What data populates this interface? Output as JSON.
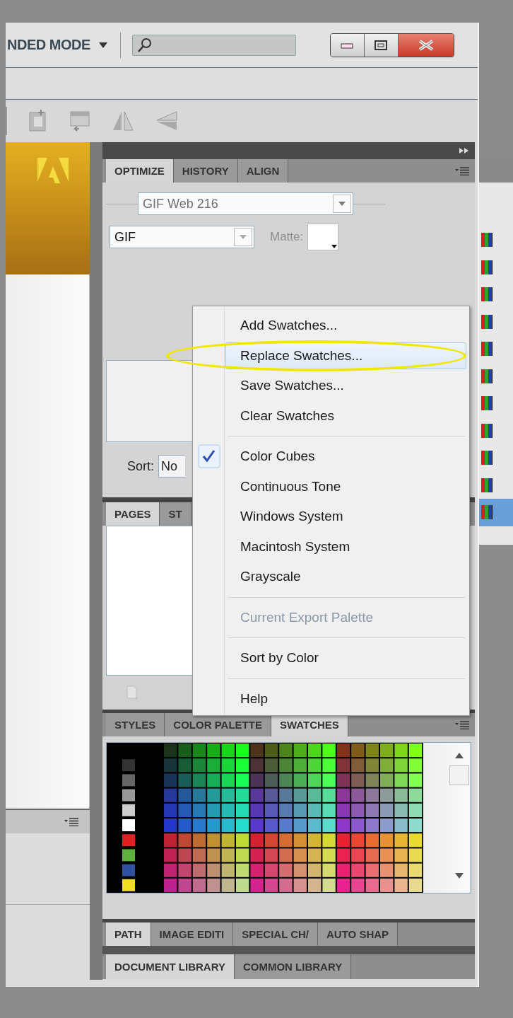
{
  "title_bar": {
    "mode_label": "NDED MODE"
  },
  "optimize_panel": {
    "tabs": [
      {
        "label": "OPTIMIZE",
        "selected": true
      },
      {
        "label": "HISTORY",
        "selected": false
      },
      {
        "label": "ALIGN",
        "selected": false
      }
    ],
    "preset": {
      "value": "GIF Web 216",
      "disabled": true
    },
    "format": {
      "value": "GIF",
      "disabled": false
    },
    "matte": {
      "label": "Matte:",
      "disabled": true
    },
    "sort": {
      "label": "Sort:",
      "value": "No"
    }
  },
  "pages_panel": {
    "tabs": [
      {
        "label": "PAGES",
        "selected": true
      },
      {
        "label": "ST",
        "selected": false
      }
    ]
  },
  "swatches_panel": {
    "tabs": [
      {
        "label": "STYLES",
        "selected": false
      },
      {
        "label": "COLOR PALETTE",
        "selected": false
      },
      {
        "label": "SWATCHES",
        "selected": true
      }
    ]
  },
  "path_panel": {
    "tabs": [
      {
        "label": "PATH",
        "selected": true
      },
      {
        "label": "IMAGE EDITI",
        "selected": false
      },
      {
        "label": "SPECIAL CH/",
        "selected": false
      },
      {
        "label": "AUTO SHAP",
        "selected": false
      }
    ]
  },
  "library_panel": {
    "tabs": [
      {
        "label": "DOCUMENT LIBRARY",
        "selected": true
      },
      {
        "label": "COMMON LIBRARY",
        "selected": false
      }
    ]
  },
  "context_menu": {
    "items": [
      {
        "kind": "item",
        "label": "Add Swatches...",
        "checked": false,
        "disabled": false,
        "highlighted": false
      },
      {
        "kind": "item",
        "label": "Replace Swatches...",
        "checked": false,
        "disabled": false,
        "highlighted": true
      },
      {
        "kind": "item",
        "label": "Save Swatches...",
        "checked": false,
        "disabled": false,
        "highlighted": false
      },
      {
        "kind": "item",
        "label": "Clear Swatches",
        "checked": false,
        "disabled": false,
        "highlighted": false
      },
      {
        "kind": "separator"
      },
      {
        "kind": "item",
        "label": "Color Cubes",
        "checked": true,
        "disabled": false,
        "highlighted": false
      },
      {
        "kind": "item",
        "label": "Continuous Tone",
        "checked": false,
        "disabled": false,
        "highlighted": false
      },
      {
        "kind": "item",
        "label": "Windows System",
        "checked": false,
        "disabled": false,
        "highlighted": false
      },
      {
        "kind": "item",
        "label": "Macintosh System",
        "checked": false,
        "disabled": false,
        "highlighted": false
      },
      {
        "kind": "item",
        "label": "Grayscale",
        "checked": false,
        "disabled": false,
        "highlighted": false
      },
      {
        "kind": "separator"
      },
      {
        "kind": "item",
        "label": "Current Export Palette",
        "checked": false,
        "disabled": true,
        "highlighted": false
      },
      {
        "kind": "separator"
      },
      {
        "kind": "item",
        "label": "Sort by Color",
        "checked": false,
        "disabled": false,
        "highlighted": false
      },
      {
        "kind": "separator"
      },
      {
        "kind": "item",
        "label": "Help",
        "checked": false,
        "disabled": false,
        "highlighted": false
      }
    ]
  }
}
